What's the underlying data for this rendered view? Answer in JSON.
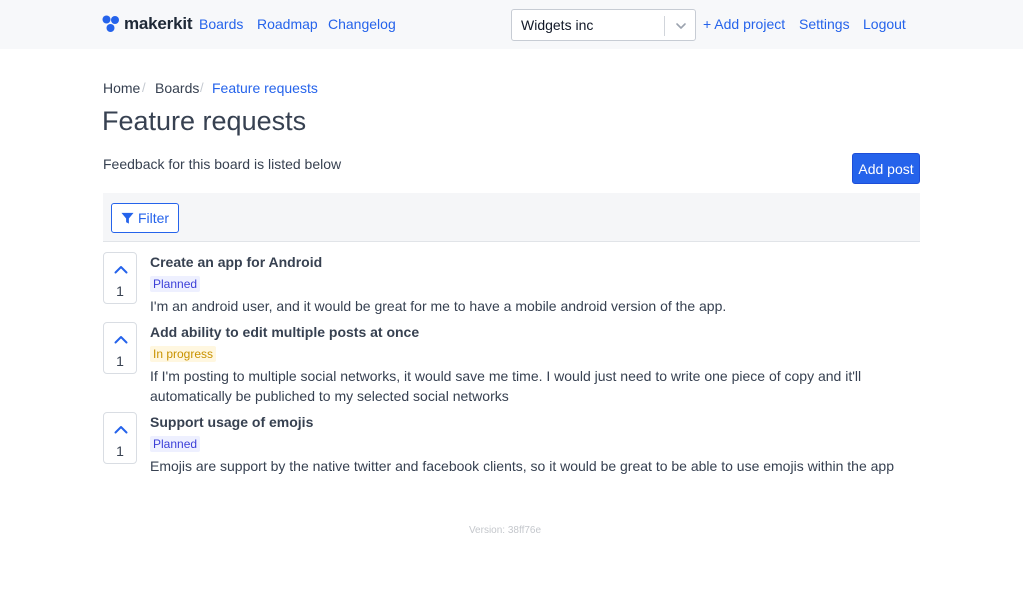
{
  "brand": {
    "name": "makerkit"
  },
  "nav": {
    "links": [
      "Boards",
      "Roadmap",
      "Changelog"
    ],
    "project_select": "Widgets inc",
    "add_project": "+ Add project",
    "settings": "Settings",
    "logout": "Logout"
  },
  "breadcrumb": [
    "Home",
    "Boards",
    "Feature requests"
  ],
  "page": {
    "title": "Feature requests",
    "subtitle": "Feedback for this board is listed below",
    "add_post": "Add post",
    "filter": "Filter"
  },
  "posts": [
    {
      "votes": "1",
      "title": "Create an app for Android",
      "status": "Planned",
      "description": "I'm an android user, and it would be great for me to have a mobile android version of the app."
    },
    {
      "votes": "1",
      "title": "Add ability to edit multiple posts at once",
      "status": "In progress",
      "description": "If I'm posting to multiple social networks, it would save me time. I would just need to write one piece of copy and it'll automatically be publiched to my selected social networks"
    },
    {
      "votes": "1",
      "title": "Support usage of emojis",
      "status": "Planned",
      "description": "Emojis are support by the native twitter and facebook clients, so it would be great to be able to use emojis within the app"
    }
  ],
  "footer": {
    "version": "Version: 38ff76e"
  },
  "colors": {
    "accent": "#2563eb",
    "planned": "#3b3fd8",
    "in_progress": "#c89200"
  },
  "icons": {
    "brand": "makerkit-logo-icon",
    "select": "chevron-down-icon",
    "filter": "filter-icon",
    "vote": "chevron-up-icon"
  }
}
